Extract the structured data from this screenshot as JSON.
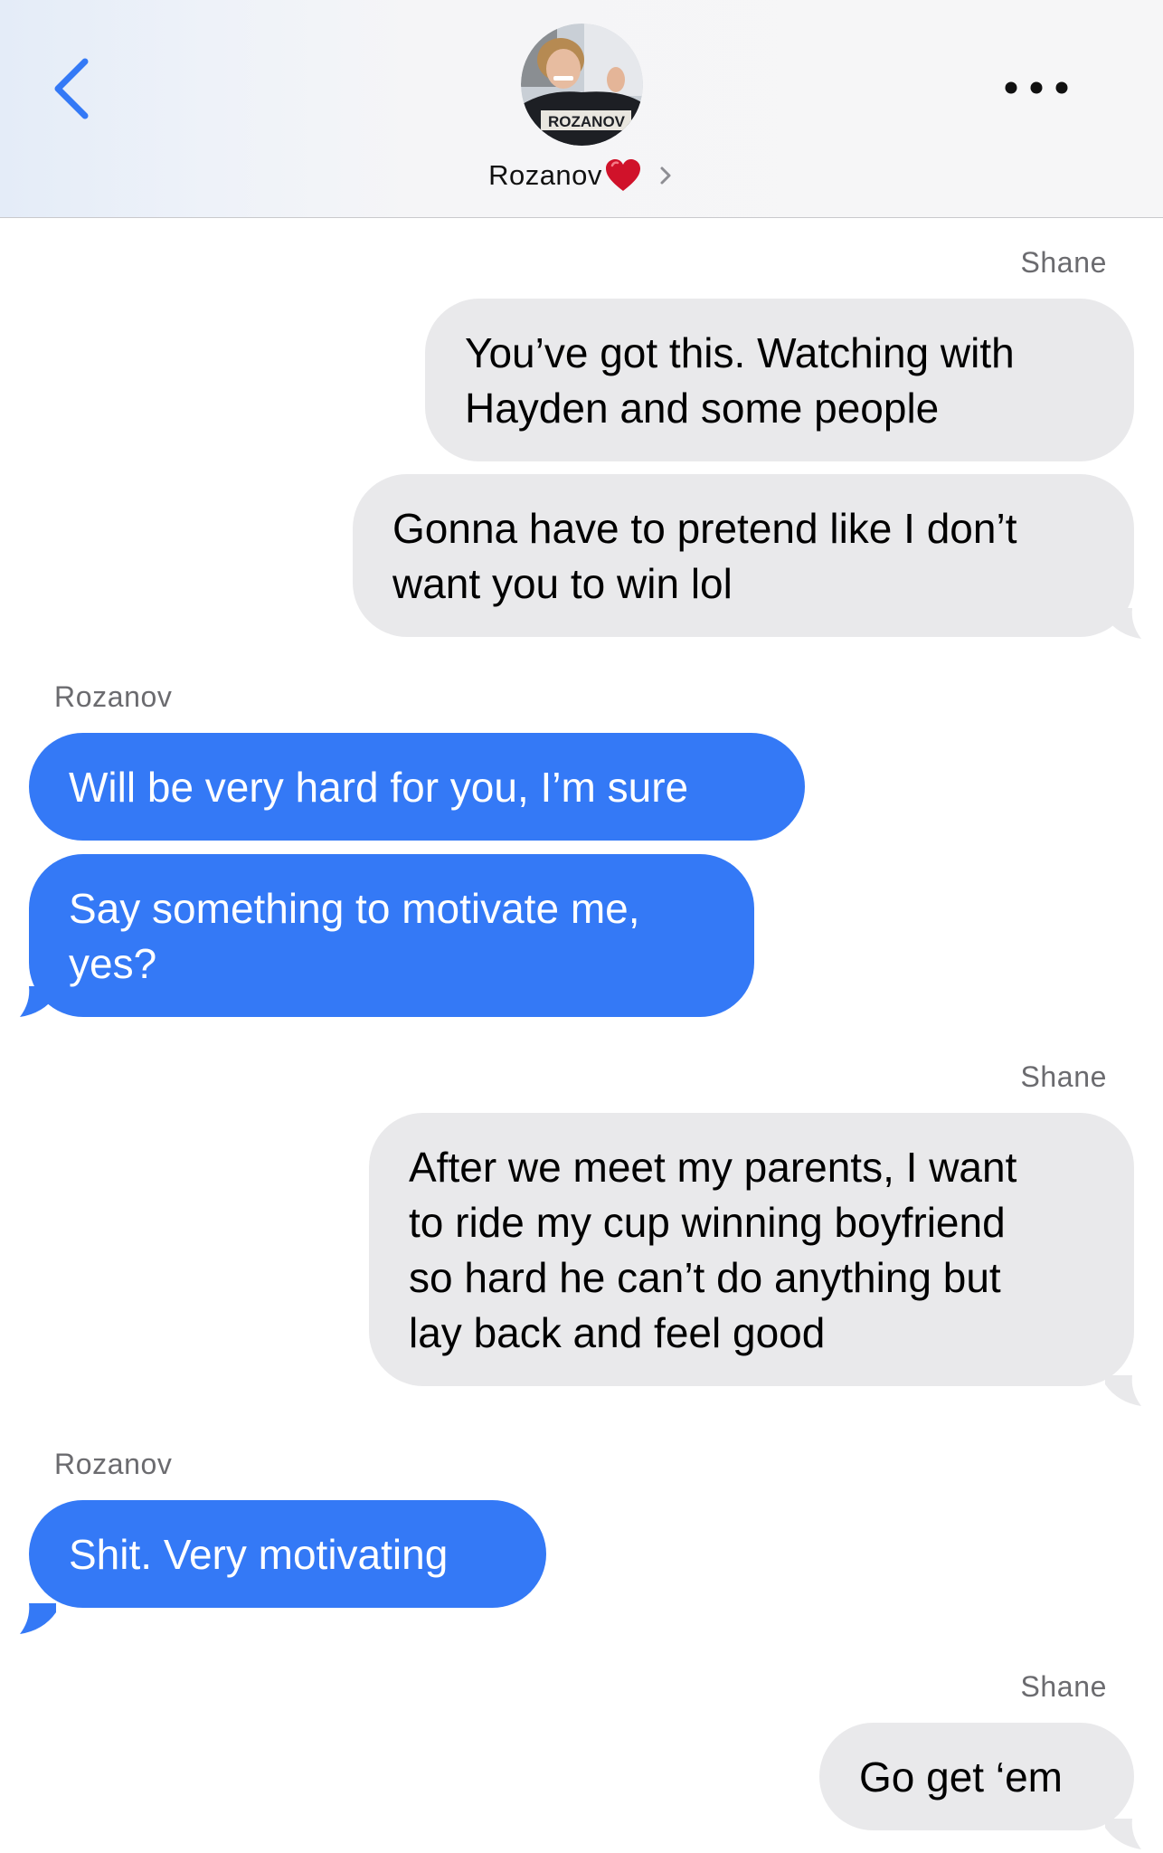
{
  "header": {
    "contact_name": "Rozanov",
    "avatar_jersey_text": "ROZANOV",
    "heart_emoji": "heart-icon",
    "back_icon": "chevron-left-icon",
    "more_icon": "ellipsis-icon",
    "accent_color": "#3479f6"
  },
  "messages": [
    {
      "sender": "Shane",
      "direction": "outgoing",
      "text": "You’ve got this. Watching with\nHayden and some people"
    },
    {
      "sender": "Shane",
      "direction": "outgoing",
      "text": "Gonna have to pretend like I don’t\nwant you to win lol"
    },
    {
      "sender": "Rozanov",
      "direction": "incoming",
      "text": "Will be very hard for you, I’m sure"
    },
    {
      "sender": "Rozanov",
      "direction": "incoming",
      "text": "Say something to motivate me,\nyes?"
    },
    {
      "sender": "Shane",
      "direction": "outgoing",
      "text": "After we meet my parents, I want\nto ride my cup winning boyfriend\nso hard he can’t do anything but\nlay back and feel good"
    },
    {
      "sender": "Rozanov",
      "direction": "incoming",
      "text": "Shit. Very motivating"
    },
    {
      "sender": "Shane",
      "direction": "outgoing",
      "text": "Go get ‘em"
    }
  ],
  "sender_labels": [
    "Shane",
    "Rozanov",
    "Shane",
    "Rozanov",
    "Shane"
  ],
  "colors": {
    "incoming_bubble": "#3479f6",
    "outgoing_bubble": "#e9e9eb",
    "sender_label": "#6b6b6f"
  }
}
